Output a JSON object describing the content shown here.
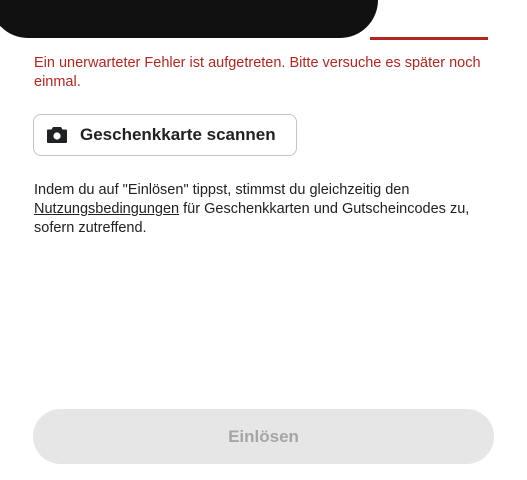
{
  "error": {
    "message": "Ein unerwarteter Fehler ist aufgetreten. Bitte versuche es später noch einmal."
  },
  "scan_button": {
    "label": "Geschenkkarte scannen",
    "icon": "camera-icon"
  },
  "terms": {
    "prefix": "Indem du auf \"Einlösen\" tippst, stimmst du gleichzeitig den ",
    "link": "Nutzungsbedingungen",
    "suffix": " für Geschenkkarten und Gutscheincodes zu, sofern zutreffend."
  },
  "redeem_button": {
    "label": "Einlösen",
    "state": "disabled"
  },
  "colors": {
    "error": "#b3261e",
    "text": "#202124",
    "disabled_bg": "#e6e6e6",
    "disabled_text": "#a5a5a5"
  }
}
